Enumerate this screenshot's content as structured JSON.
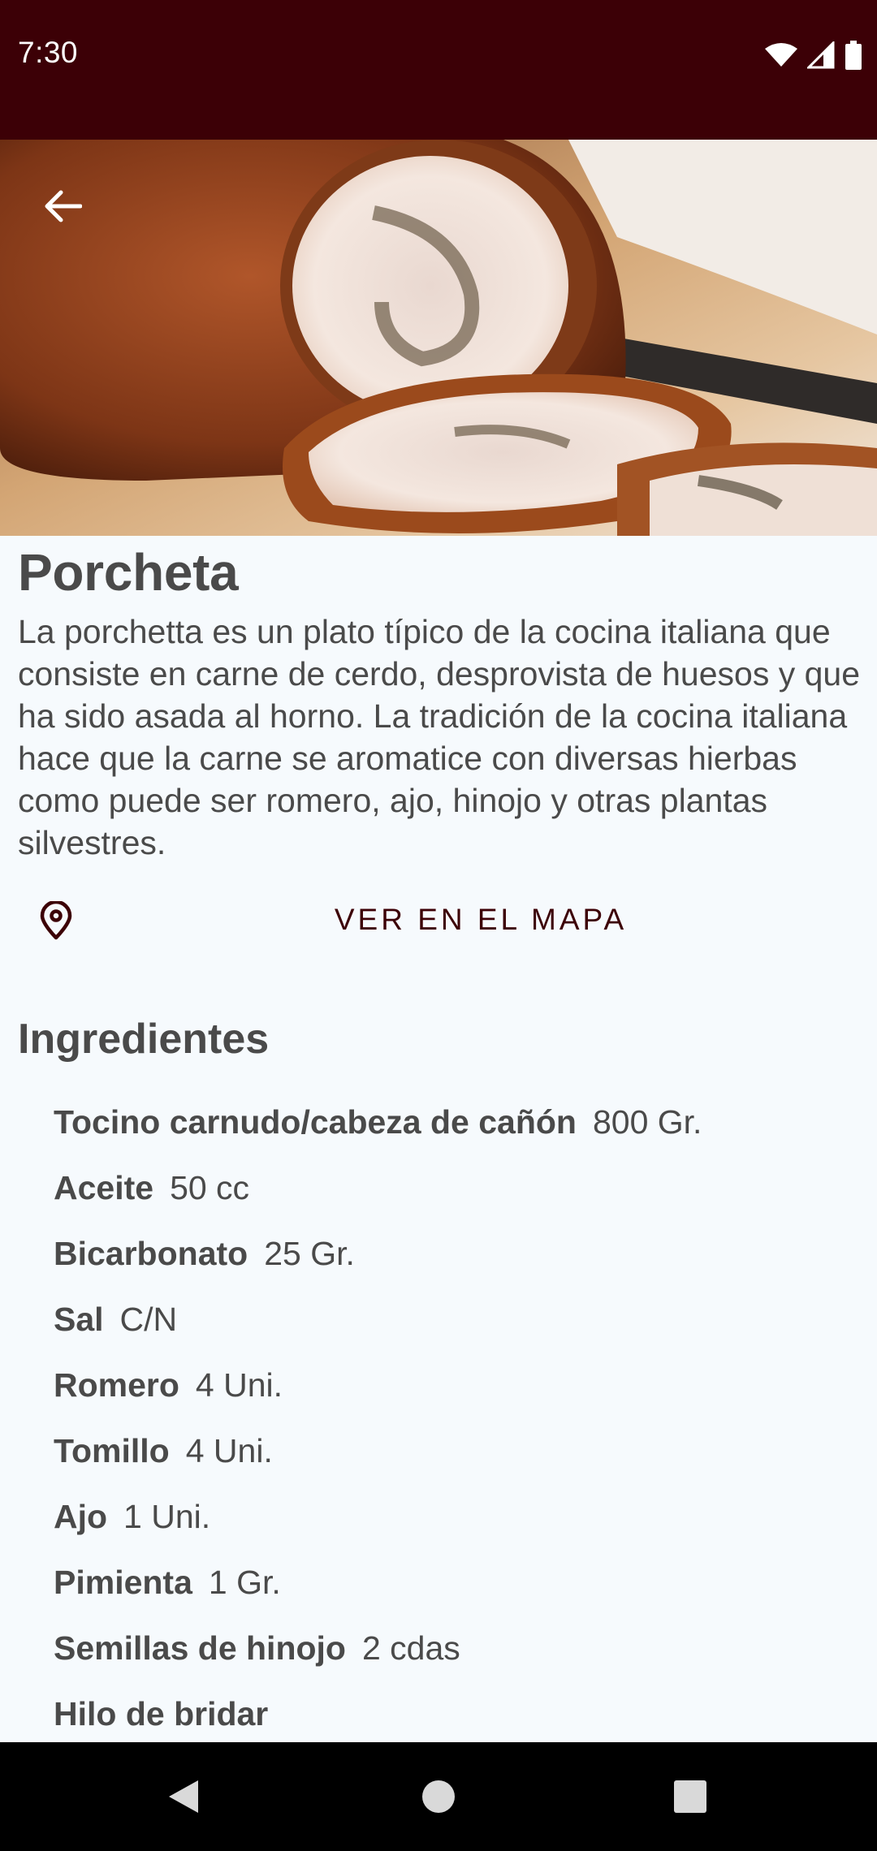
{
  "status_bar": {
    "time": "7:30",
    "background": "#3c0006",
    "icons": [
      "wifi-icon",
      "signal-icon",
      "battery-icon"
    ]
  },
  "header": {
    "back_icon": "arrow-left-icon",
    "hero_image": "porchetta roast photo"
  },
  "recipe": {
    "title": "Porcheta",
    "description": "La porchetta es un plato típico de la cocina italiana que consiste en carne de cerdo, desprovista de huesos y que ha sido asada al horno. La tradición de la cocina italiana hace que la carne se aromatice con diversas hierbas como puede ser romero, ajo, hinojo y otras plantas silvestres.",
    "map_button": {
      "label": "VER EN EL MAPA",
      "icon": "map-pin-icon",
      "color": "#3c0006"
    },
    "ingredients_title": "Ingredientes",
    "ingredients": [
      {
        "name": "Tocino carnudo/cabeza de cañón",
        "qty": "800 Gr."
      },
      {
        "name": "Aceite",
        "qty": "50 cc"
      },
      {
        "name": "Bicarbonato",
        "qty": "25 Gr."
      },
      {
        "name": "Sal",
        "qty": "C/N"
      },
      {
        "name": "Romero",
        "qty": "4 Uni."
      },
      {
        "name": "Tomillo",
        "qty": "4 Uni."
      },
      {
        "name": "Ajo",
        "qty": "1 Uni."
      },
      {
        "name": "Pimienta",
        "qty": "1 Gr."
      },
      {
        "name": "Semillas de hinojo",
        "qty": "2 cdas"
      },
      {
        "name": "Hilo de bridar",
        "qty": ""
      }
    ]
  },
  "nav_bar": {
    "icons": [
      "back-triangle-icon",
      "home-circle-icon",
      "recents-square-icon"
    ]
  }
}
